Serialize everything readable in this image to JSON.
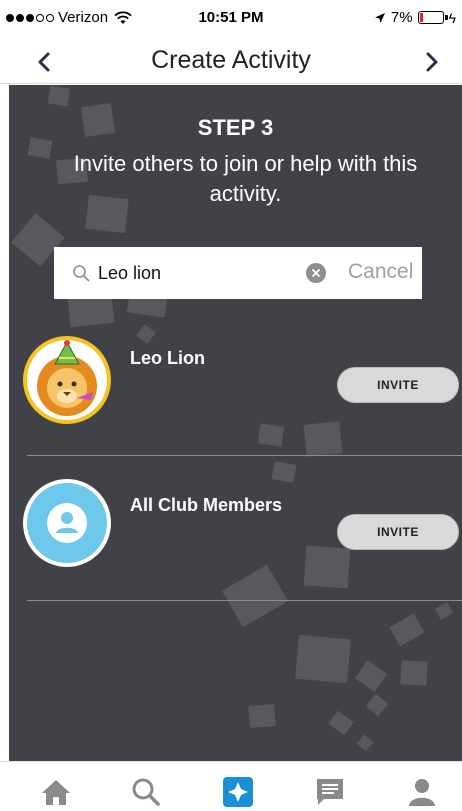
{
  "status_bar": {
    "carrier": "Verizon",
    "time": "10:51 PM",
    "battery_percent": "7%",
    "signal_bars_filled": 3,
    "signal_bars_total": 5
  },
  "nav": {
    "title": "Create Activity",
    "back_icon": "chevron-left-icon",
    "forward_icon": "chevron-right-icon"
  },
  "step": {
    "title": "STEP 3",
    "description": "Invite others to join or help with this activity."
  },
  "search": {
    "value": "Leo lion",
    "placeholder": "Search",
    "cancel_label": "Cancel"
  },
  "members": [
    {
      "name": "Leo Lion",
      "avatar": "lion-avatar",
      "action_label": "INVITE"
    },
    {
      "name": "All Club Members",
      "avatar": "group-person-icon",
      "action_label": "INVITE"
    }
  ],
  "tabs": [
    {
      "icon": "home-icon",
      "active": false
    },
    {
      "icon": "search-icon",
      "active": false
    },
    {
      "icon": "create-star-icon",
      "active": true
    },
    {
      "icon": "chat-icon",
      "active": false
    },
    {
      "icon": "profile-icon",
      "active": false
    }
  ],
  "colors": {
    "panel_bg": "#404247",
    "accent": "#1a8fd6",
    "inactive_tab": "#8a8a8a",
    "avatar_ring": "#f6c322",
    "group_avatar_bg": "#6ec8ec"
  }
}
